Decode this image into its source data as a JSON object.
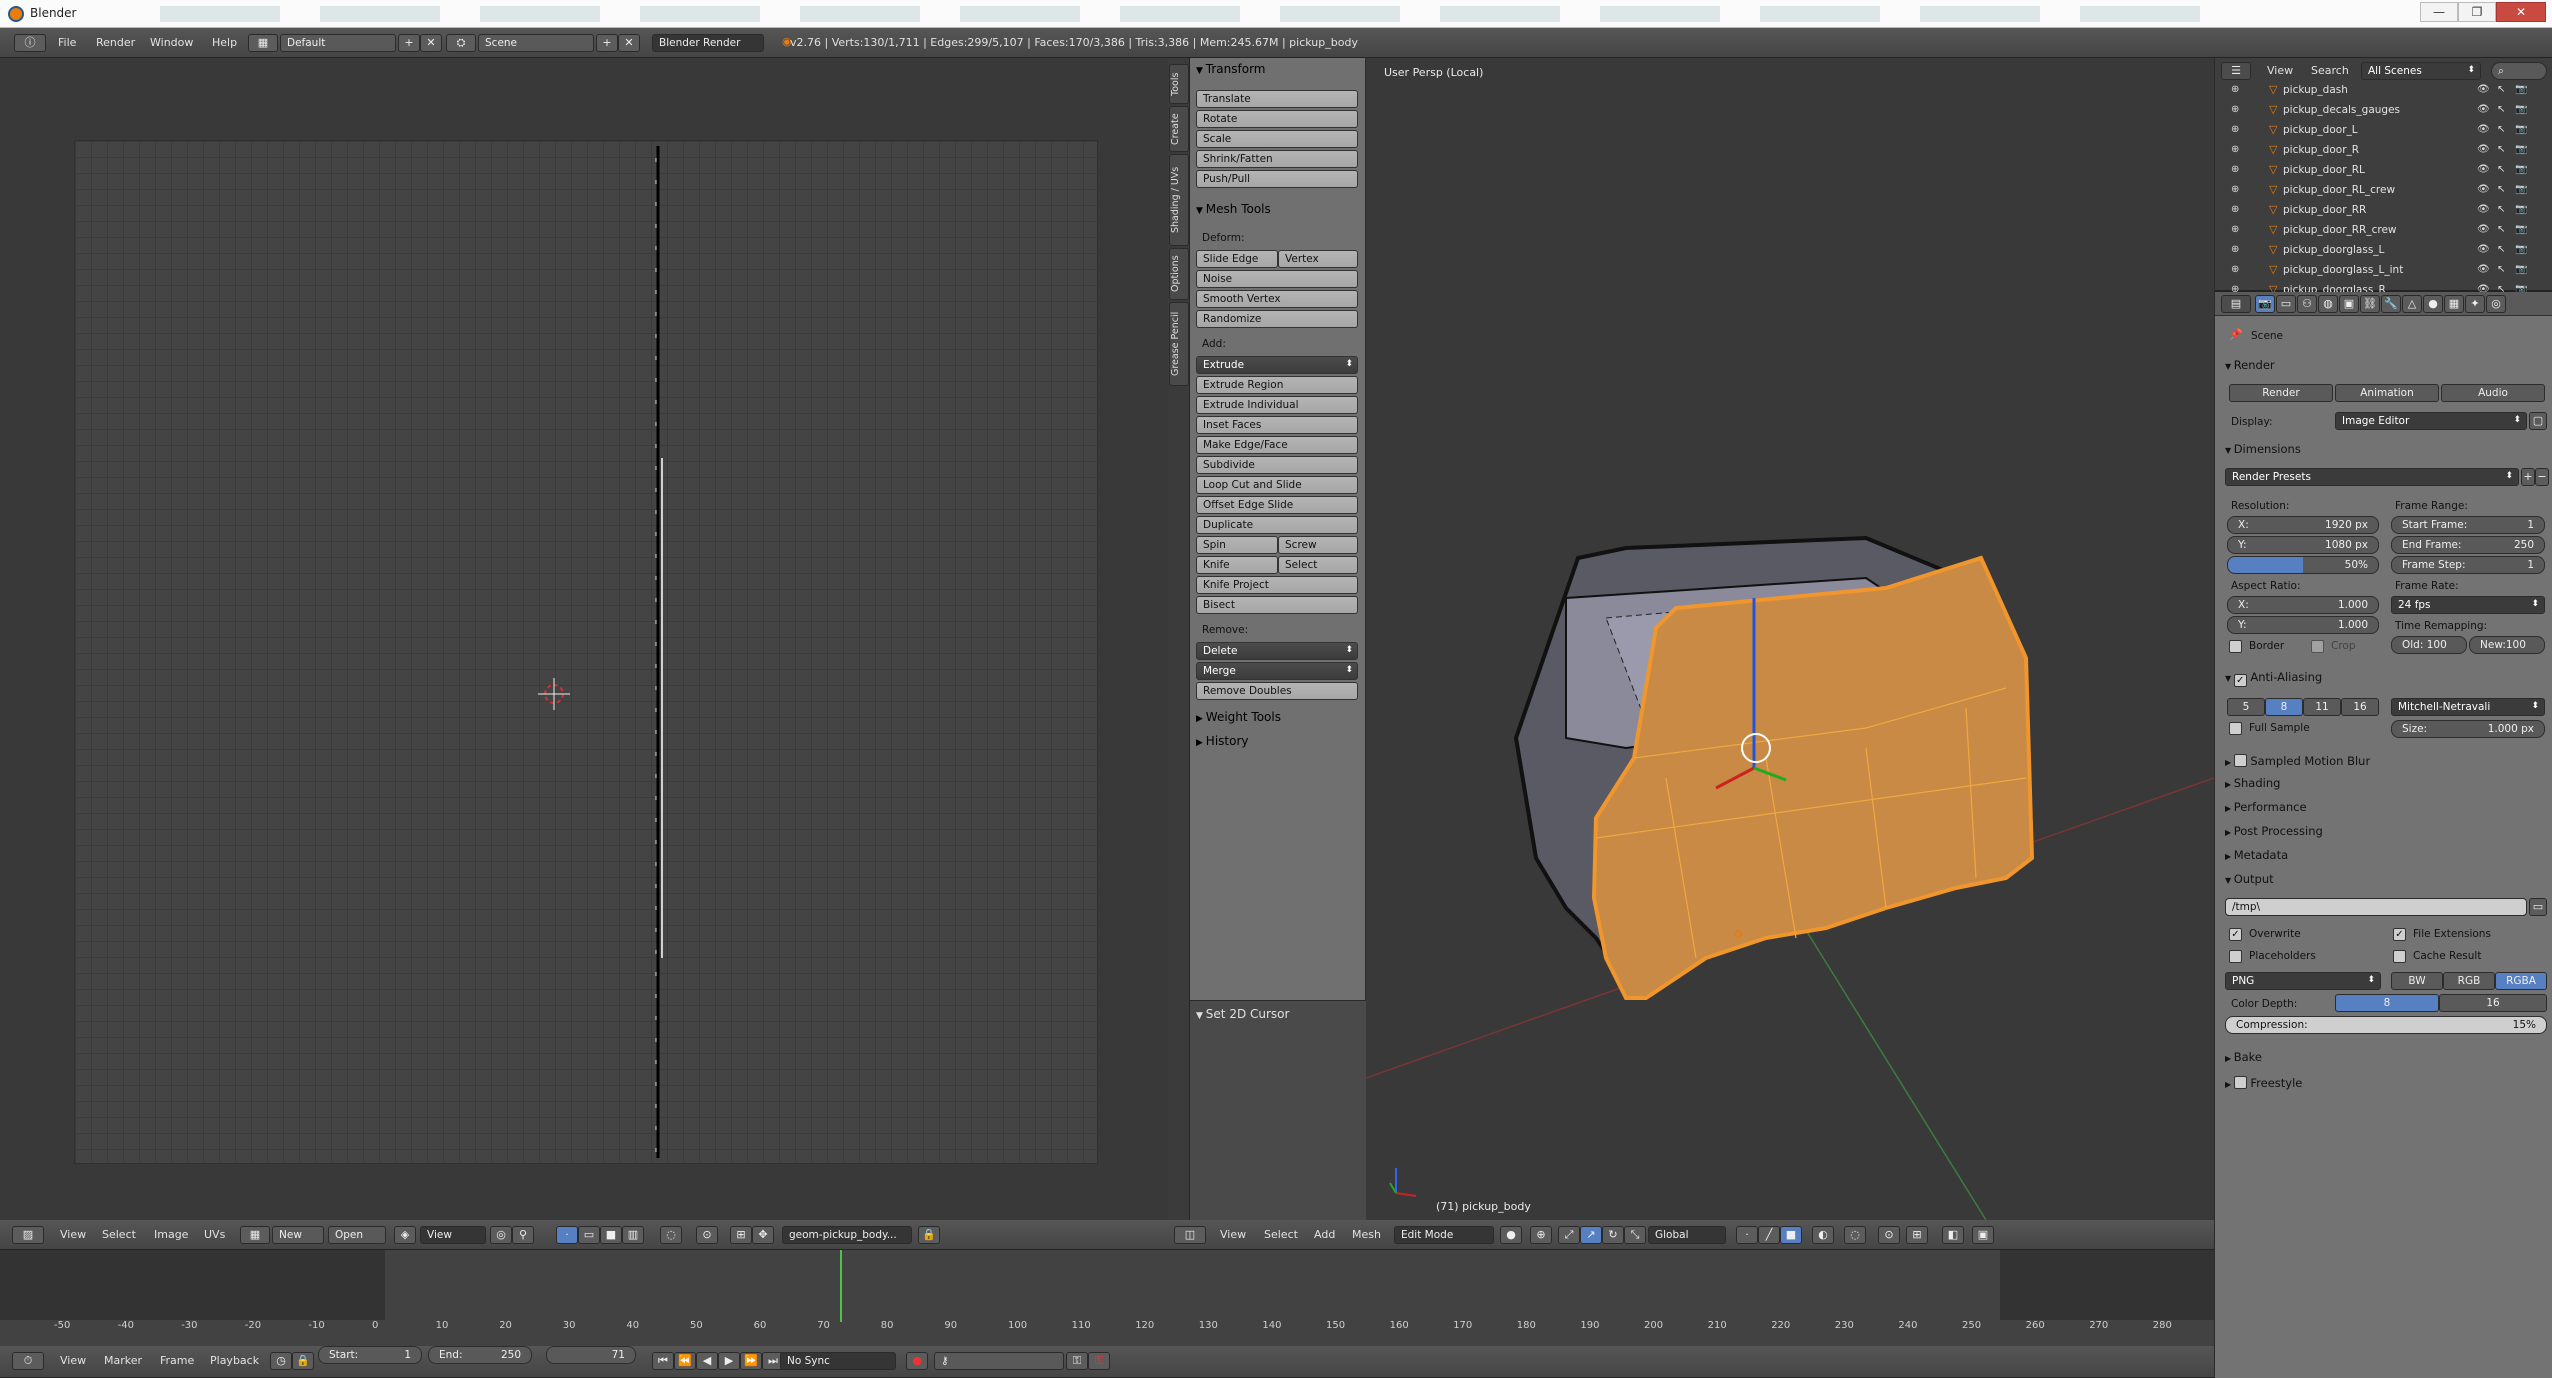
{
  "window": {
    "title": "Blender",
    "min": "—",
    "max": "❐",
    "close": "✕"
  },
  "topbar": {
    "menus": [
      "File",
      "Render",
      "Window",
      "Help"
    ],
    "screen": "Default",
    "scene": "Scene",
    "engine": "Blender Render",
    "stats": "v2.76 | Verts:130/1,711 | Edges:299/5,107 | Faces:170/3,386 | Tris:3,386 | Mem:245.67M | pickup_body"
  },
  "tool_tabs": [
    "Tools",
    "Create",
    "Shading / UVs",
    "Options",
    "Grease Pencil"
  ],
  "toolshelf": {
    "transform": {
      "title": "Transform",
      "buttons": [
        "Translate",
        "Rotate",
        "Scale",
        "Shrink/Fatten",
        "Push/Pull"
      ]
    },
    "mesh_tools": {
      "title": "Mesh Tools",
      "deform_label": "Deform:",
      "slide_edge": "Slide Edge",
      "vertex": "Vertex",
      "deform_buttons": [
        "Noise",
        "Smooth Vertex",
        "Randomize"
      ],
      "add_label": "Add:",
      "extrude": "Extrude",
      "add_buttons": [
        "Extrude Region",
        "Extrude Individual",
        "Inset Faces",
        "Make Edge/Face",
        "Subdivide",
        "Loop Cut and Slide",
        "Offset Edge Slide",
        "Duplicate"
      ],
      "spin": "Spin",
      "screw": "Screw",
      "knife": "Knife",
      "select": "Select",
      "knife_project": "Knife Project",
      "bisect": "Bisect",
      "remove_label": "Remove:",
      "delete": "Delete",
      "merge": "Merge",
      "remove_doubles": "Remove Doubles"
    },
    "weight_tools": "Weight Tools",
    "history": "History",
    "set_cursor": "Set 2D Cursor"
  },
  "viewport": {
    "label": "User Persp (Local)",
    "object_label": "(71) pickup_body"
  },
  "outliner": {
    "view": "View",
    "search": "Search",
    "scenes": "All Scenes",
    "items": [
      "pickup_dash",
      "pickup_decals_gauges",
      "pickup_door_L",
      "pickup_door_R",
      "pickup_door_RL",
      "pickup_door_RL_crew",
      "pickup_door_RR",
      "pickup_door_RR_crew",
      "pickup_doorglass_L",
      "pickup_doorglass_L_int",
      "pickup_doorglass_R"
    ]
  },
  "properties": {
    "scene": "Scene",
    "render_section": "Render",
    "render_btn": "Render",
    "animation_btn": "Animation",
    "audio_btn": "Audio",
    "display_label": "Display:",
    "display_value": "Image Editor",
    "dimensions": "Dimensions",
    "presets": "Render Presets",
    "resolution": "Resolution:",
    "res_x_label": "X:",
    "res_x": "1920 px",
    "res_y_label": "Y:",
    "res_y": "1080 px",
    "res_pct": "50%",
    "frame_range": "Frame Range:",
    "start_label": "Start Frame:",
    "start": "1",
    "end_label": "End Frame:",
    "end": "250",
    "step_label": "Frame Step:",
    "step": "1",
    "aspect": "Aspect Ratio:",
    "asp_x_label": "X:",
    "asp_x": "1.000",
    "asp_y_label": "Y:",
    "asp_y": "1.000",
    "frame_rate": "Frame Rate:",
    "fps": "24 fps",
    "time_remap": "Time Remapping:",
    "old": "Old: 100",
    "new": "New:100",
    "border": "Border",
    "crop": "Crop",
    "aa": "Anti-Aliasing",
    "aa_levels": [
      "5",
      "8",
      "11",
      "16"
    ],
    "filter": "Mitchell-Netravali",
    "full_sample": "Full Sample",
    "size_label": "Size:",
    "size": "1.000 px",
    "closed": [
      "Sampled Motion Blur",
      "Shading",
      "Performance",
      "Post Processing",
      "Metadata"
    ],
    "output": "Output",
    "path": "/tmp\\",
    "overwrite": "Overwrite",
    "file_ext": "File Extensions",
    "placeholders": "Placeholders",
    "cache": "Cache Result",
    "format": "PNG",
    "bw": "BW",
    "rgb": "RGB",
    "rgba": "RGBA",
    "color_depth": "Color Depth:",
    "depth8": "8",
    "depth16": "16",
    "compression": "Compression:",
    "compression_val": "15%",
    "bake": "Bake",
    "freestyle": "Freestyle"
  },
  "uv_header": {
    "menus": [
      "View",
      "Select",
      "Image",
      "UVs"
    ],
    "new": "New",
    "open": "Open",
    "view": "View",
    "image": "geom-pickup_body..."
  },
  "vp_header": {
    "menus": [
      "View",
      "Select",
      "Add",
      "Mesh"
    ],
    "mode": "Edit Mode",
    "orientation": "Global"
  },
  "timeline": {
    "ticks": [
      "-50",
      "-40",
      "-30",
      "-20",
      "-10",
      "0",
      "10",
      "20",
      "30",
      "40",
      "50",
      "60",
      "70",
      "80",
      "90",
      "100",
      "110",
      "120",
      "130",
      "140",
      "150",
      "160",
      "170",
      "180",
      "190",
      "200",
      "210",
      "220",
      "230",
      "240",
      "250",
      "260",
      "270",
      "280"
    ],
    "menus": [
      "View",
      "Marker",
      "Frame",
      "Playback"
    ],
    "start_label": "Start:",
    "start": "1",
    "end_label": "End:",
    "end": "250",
    "current": "71",
    "sync": "No Sync"
  }
}
